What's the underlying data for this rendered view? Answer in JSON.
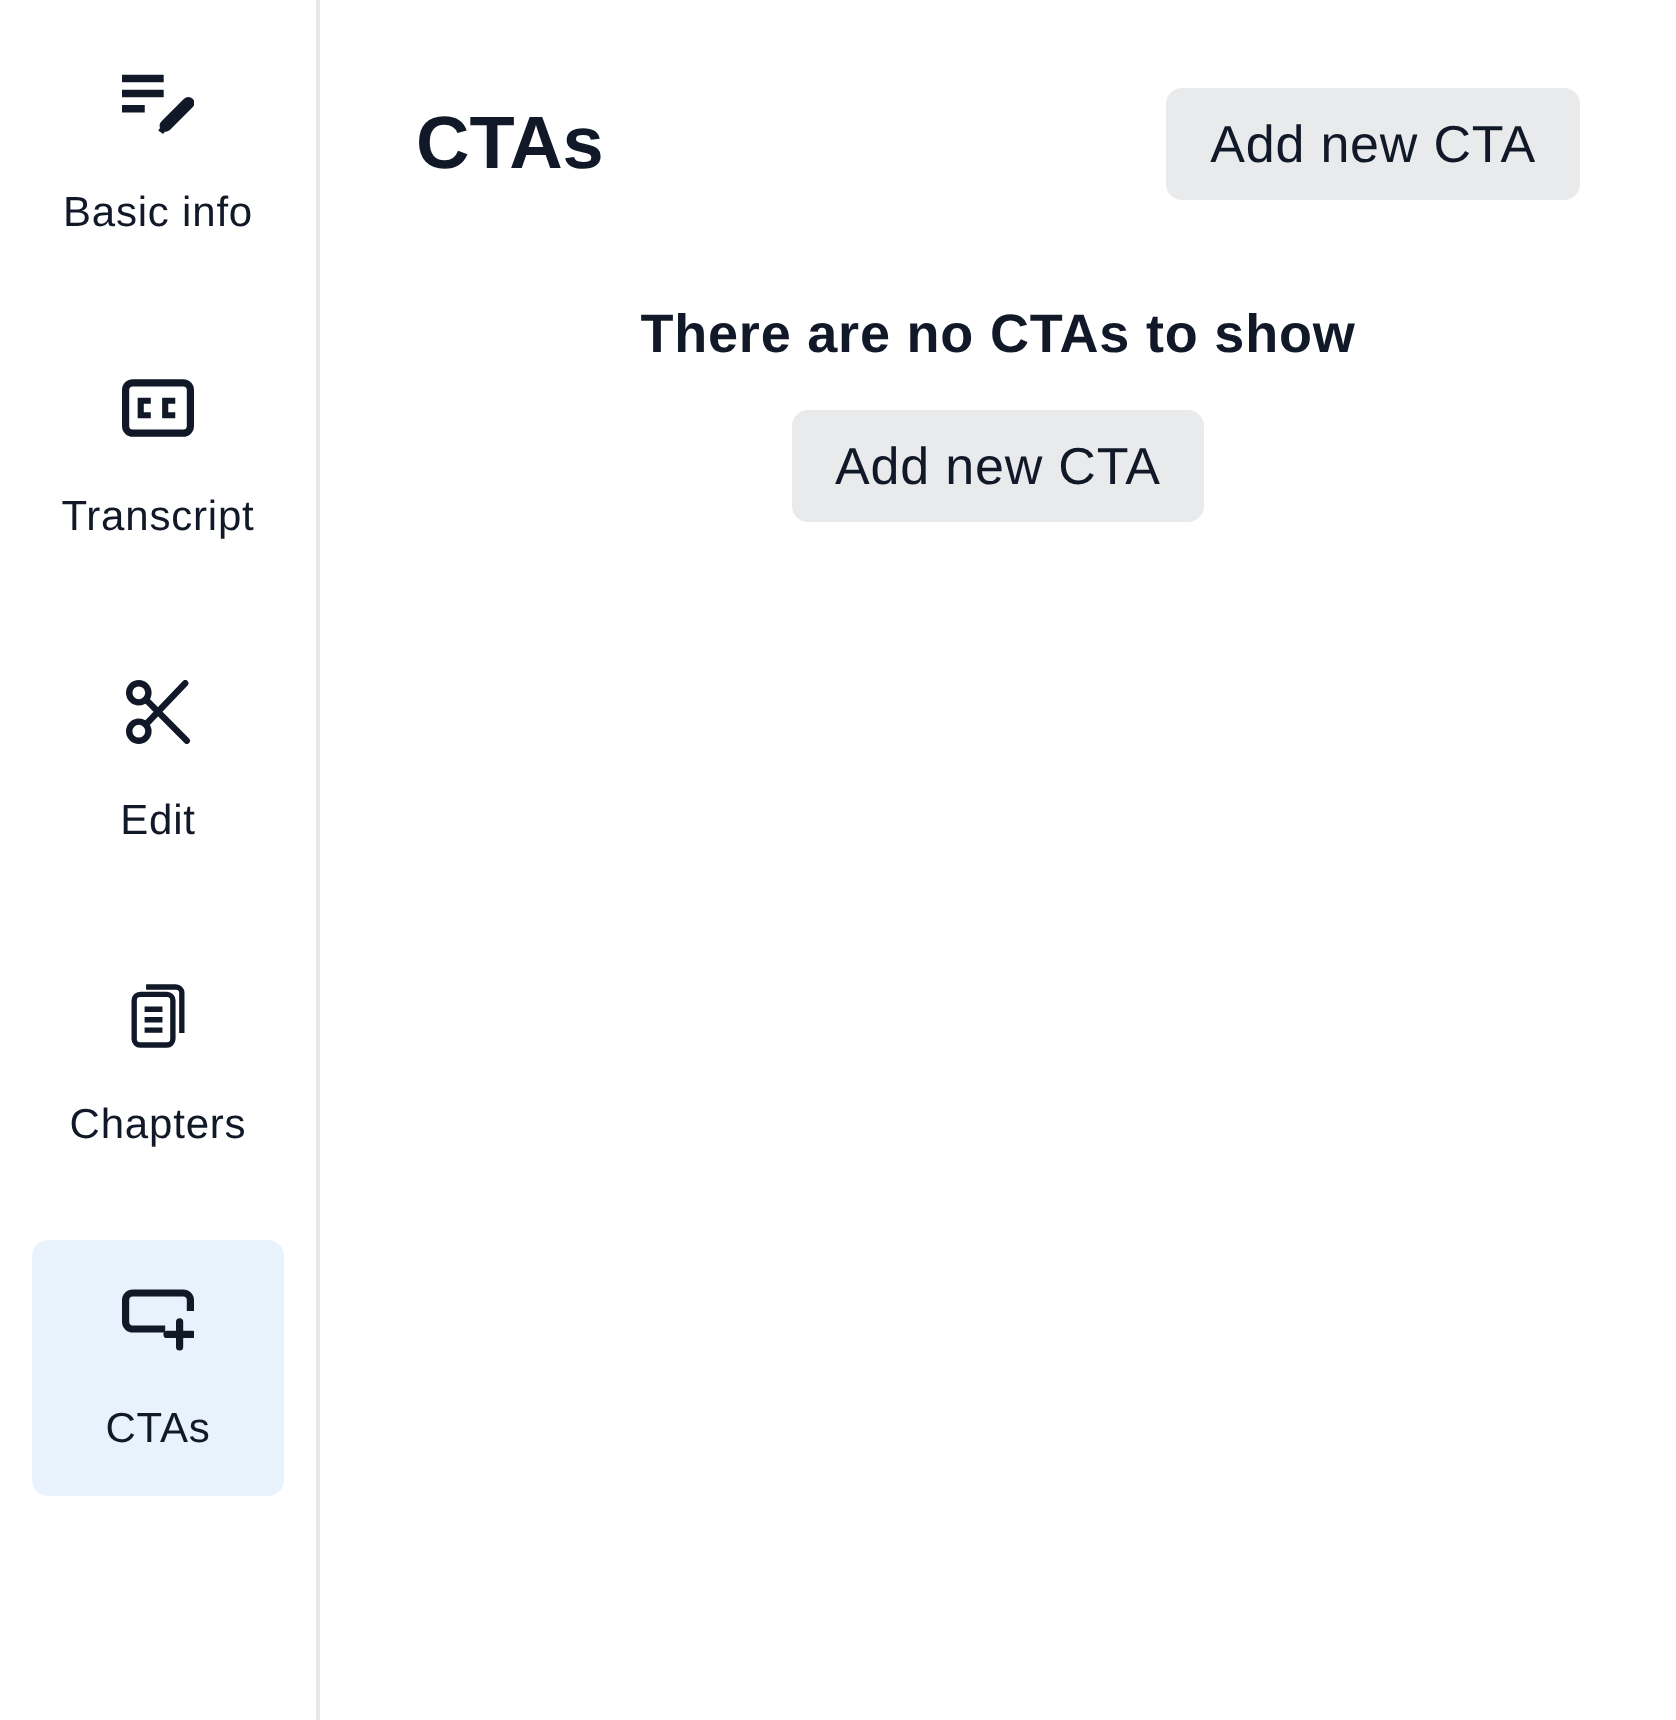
{
  "sidebar": {
    "items": [
      {
        "label": "Basic info",
        "kind": "details",
        "selected": false
      },
      {
        "label": "Transcript",
        "kind": "captions",
        "selected": false
      },
      {
        "label": "Edit",
        "kind": "cut",
        "selected": false
      },
      {
        "label": "Chapters",
        "kind": "pages",
        "selected": false
      },
      {
        "label": "CTAs",
        "kind": "cta",
        "selected": true
      }
    ]
  },
  "header": {
    "title": "CTAs",
    "button": "Add new CTA"
  },
  "empty_state": {
    "message": "There are no CTAs to show",
    "button": "Add new CTA"
  }
}
